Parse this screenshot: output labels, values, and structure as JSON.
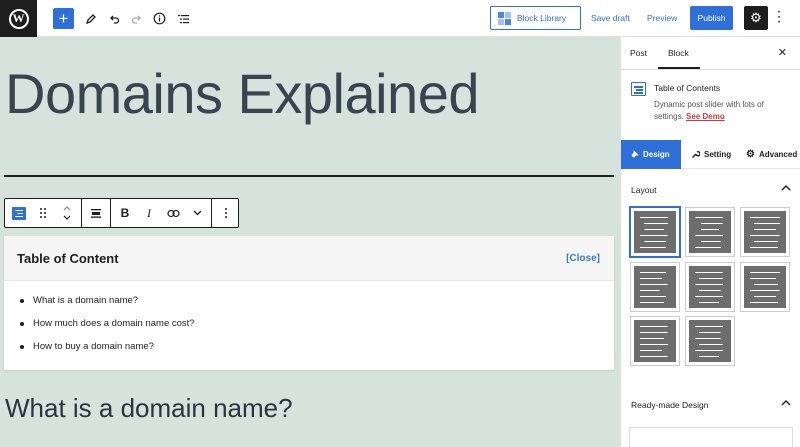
{
  "topbar": {
    "logo_icon": "wordpress-logo",
    "add_icon": "+",
    "block_library_label": "Block Library",
    "save_draft_label": "Save draft",
    "preview_label": "Preview",
    "publish_label": "Publish",
    "settings_icon": "⚙",
    "more_icon": "⋮"
  },
  "editor": {
    "post_title": "Domains Explained",
    "toc": {
      "title": "Table of Content",
      "close_label": "[Close]",
      "items": [
        "What is a domain name?",
        "How much does a domain name cost?",
        "How to buy a domain name?"
      ]
    },
    "heading": "What is a domain name?",
    "toolbar": {
      "bold": "B",
      "italic": "I"
    }
  },
  "sidebar": {
    "tabs": [
      "Post",
      "Block"
    ],
    "active_tab": "Block",
    "close_icon": "✕",
    "block": {
      "name": "Table of Contents",
      "description": "Dynamic post slider with lots of settings.",
      "demo_link": "See Demo"
    },
    "subtabs": [
      "Design",
      "Setting",
      "Advanced"
    ],
    "active_subtab": "Design",
    "sections": {
      "layout": "Layout",
      "ready_made": "Ready-made Design"
    }
  },
  "colors": {
    "accent": "#2f6fd9",
    "canvas_bg": "#d6e3dd",
    "demo_link": "#d63638"
  }
}
